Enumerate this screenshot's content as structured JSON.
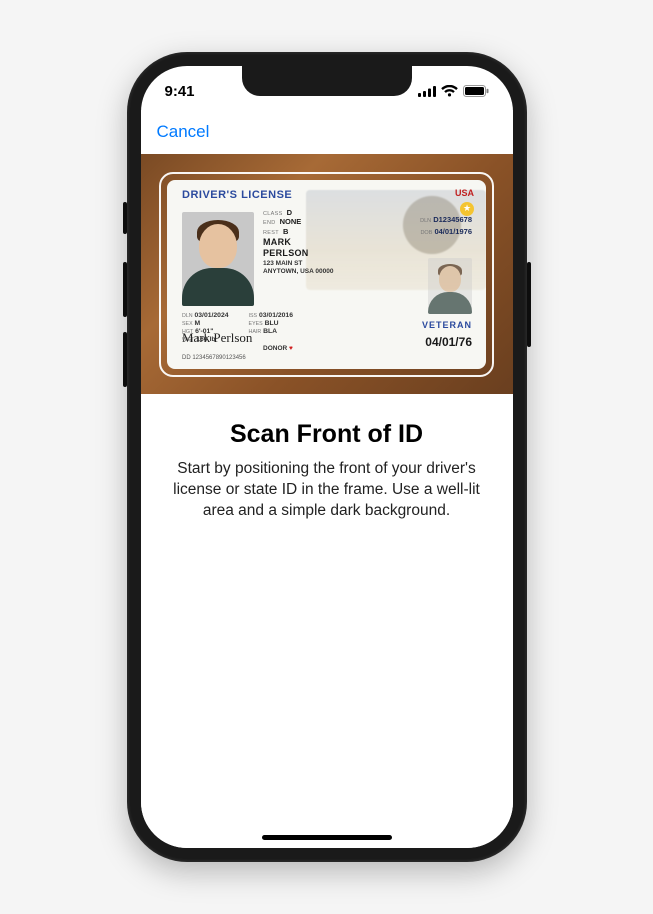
{
  "status_bar": {
    "time": "9:41"
  },
  "nav": {
    "cancel_label": "Cancel"
  },
  "id_card": {
    "title": "DRIVER'S LICENSE",
    "country": "USA",
    "class_lbl": "CLASS",
    "class_val": "D",
    "end_lbl": "END",
    "end_val": "NONE",
    "rest_lbl": "REST",
    "rest_val": "B",
    "last_name": "MARK",
    "first_name": "PERLSON",
    "addr1": "123 MAIN ST",
    "addr2": "ANYTOWN, USA 00000",
    "dln_lbl": "DLN",
    "dln_val": "D12345678",
    "dob_lbl": "DOB",
    "dob_val": "04/01/1976",
    "exp_lbl": "DLN",
    "exp_val": "03/01/2024",
    "iss_lbl": "ISS",
    "iss_val": "03/01/2016",
    "sex_lbl": "SEX",
    "sex_val": "M",
    "eyes_lbl": "EYES",
    "eyes_val": "BLU",
    "hgt_lbl": "HGT",
    "hgt_val": "6'-01\"",
    "hair_lbl": "HAIR",
    "hair_val": "BLA",
    "wgt_lbl": "WGT",
    "wgt_val": "160 lb",
    "donor": "DONOR",
    "veteran": "VETERAN",
    "big_date": "04/01/76",
    "signature": "Mark Perlson",
    "dd_lbl": "DD",
    "dd_val": "1234567890123456"
  },
  "instructions": {
    "headline": "Scan Front of ID",
    "body": "Start by positioning the front of your driver's license or state ID in the frame. Use a well-lit area and a simple dark background."
  }
}
